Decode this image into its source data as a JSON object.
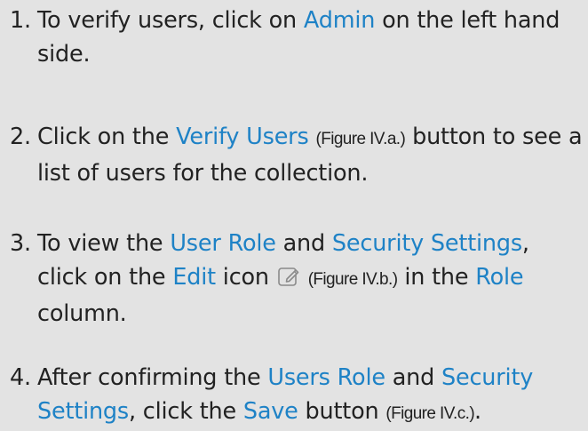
{
  "steps": [
    {
      "number": "1.",
      "t1": "To verify users, click on ",
      "h1": "Admin",
      "t2": " on the left hand side."
    },
    {
      "number": "2.",
      "t1": "Click on the ",
      "h1": "Verify Users",
      "fig": "(Figure IV.a.)",
      "t2": " button to see a list of users for the collection."
    },
    {
      "number": "3.",
      "t1": "To view the ",
      "h1": "User Role",
      "t2": " and ",
      "h2": "Security Settings",
      "t3": ", click on the ",
      "h3": "Edit",
      "t4": " icon ",
      "icon": "edit-icon",
      "fig": "(Figure IV.b.)",
      "t5": " in the ",
      "h4": "Role",
      "t6": " column."
    },
    {
      "number": "4.",
      "t1": "After confirming the ",
      "h1": "Users Role",
      "t2": " and ",
      "h2": "Security Settings",
      "t3": ", click the ",
      "h3": "Save",
      "t4": " button ",
      "fig": "(Figure IV.c.)",
      "t5": "."
    }
  ],
  "colors": {
    "background": "#e3e3e3",
    "text": "#222222",
    "highlight": "#1e82c6",
    "icon": "#8a8a8a"
  }
}
